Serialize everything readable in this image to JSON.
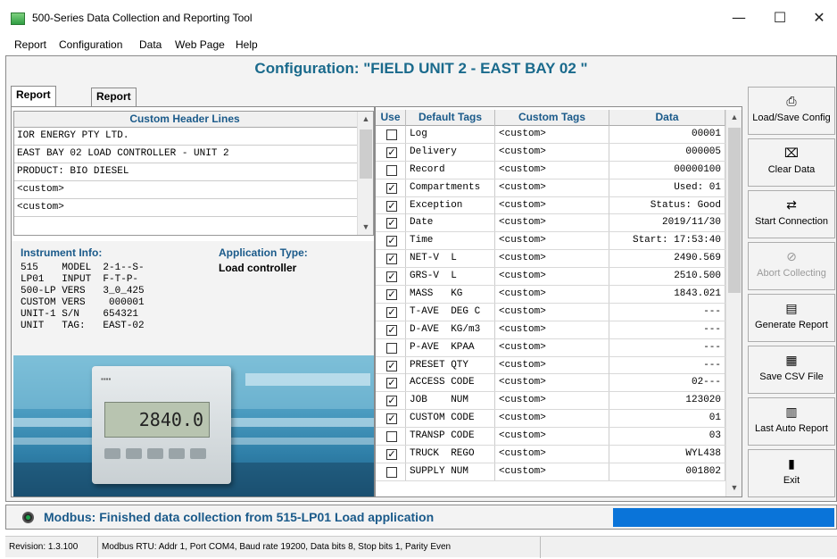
{
  "window": {
    "title": "500-Series Data Collection and Reporting Tool",
    "controls": {
      "minimize": "—",
      "maximize": "☐",
      "close": "✕"
    }
  },
  "menu": [
    "Report",
    "Configuration",
    "Data",
    "Web Page",
    "Help"
  ],
  "config_title": "Configuration: \"FIELD UNIT 2 - EAST BAY 02 \"",
  "tabs": [
    "Report Items",
    "Report Data"
  ],
  "header_lines": {
    "column": "Custom Header Lines",
    "lines": [
      "IOR ENERGY PTY LTD.",
      "EAST BAY 02 LOAD CONTROLLER - UNIT 2",
      "PRODUCT: BIO DIESEL",
      "<custom>",
      "<custom>",
      ""
    ]
  },
  "instrument": {
    "label": "Instrument Info:",
    "lines": [
      "515    MODEL  2-1--S-",
      "LP01   INPUT  F-T-P-",
      "500-LP VERS   3_0_425",
      "CUSTOM VERS    000001",
      "UNIT-1 S/N    654321",
      "UNIT   TAG:   EAST-02"
    ]
  },
  "application": {
    "label": "Application Type:",
    "value": "Load controller"
  },
  "device": {
    "display": "2840.0"
  },
  "tag_table": {
    "headers": {
      "use": "Use",
      "default": "Default Tags",
      "custom": "Custom Tags",
      "data": "Data"
    },
    "rows": [
      {
        "checked": false,
        "default": "Log",
        "custom": "<custom>",
        "data": "00001"
      },
      {
        "checked": true,
        "default": "Delivery",
        "custom": "<custom>",
        "data": "000005"
      },
      {
        "checked": false,
        "default": "Record",
        "custom": "<custom>",
        "data": "00000100"
      },
      {
        "checked": true,
        "default": "Compartments",
        "custom": "<custom>",
        "data": "Used: 01"
      },
      {
        "checked": true,
        "default": "Exception",
        "custom": "<custom>",
        "data": "Status: Good"
      },
      {
        "checked": true,
        "default": "Date",
        "custom": "<custom>",
        "data": "2019/11/30"
      },
      {
        "checked": true,
        "default": "Time",
        "custom": "<custom>",
        "data": "Start: 17:53:40"
      },
      {
        "checked": true,
        "default": "NET-V  L",
        "custom": "<custom>",
        "data": "2490.569"
      },
      {
        "checked": true,
        "default": "GRS-V  L",
        "custom": "<custom>",
        "data": "2510.500"
      },
      {
        "checked": true,
        "default": "MASS   KG",
        "custom": "<custom>",
        "data": "1843.021"
      },
      {
        "checked": true,
        "default": "T-AVE  DEG C",
        "custom": "<custom>",
        "data": "---"
      },
      {
        "checked": true,
        "default": "D-AVE  KG/m3",
        "custom": "<custom>",
        "data": "---"
      },
      {
        "checked": false,
        "default": "P-AVE  KPAA",
        "custom": "<custom>",
        "data": "---"
      },
      {
        "checked": true,
        "default": "PRESET QTY",
        "custom": "<custom>",
        "data": "---"
      },
      {
        "checked": true,
        "default": "ACCESS CODE",
        "custom": "<custom>",
        "data": "02---"
      },
      {
        "checked": true,
        "default": "JOB    NUM",
        "custom": "<custom>",
        "data": "123020"
      },
      {
        "checked": true,
        "default": "CUSTOM CODE",
        "custom": "<custom>",
        "data": "01"
      },
      {
        "checked": false,
        "default": "TRANSP CODE",
        "custom": "<custom>",
        "data": "03"
      },
      {
        "checked": true,
        "default": "TRUCK  REGO",
        "custom": "<custom>",
        "data": "WYL438"
      },
      {
        "checked": false,
        "default": "SUPPLY NUM",
        "custom": "<custom>",
        "data": "001802"
      }
    ]
  },
  "side_buttons": [
    {
      "label": "Load/Save Config",
      "icon": "save-config-icon",
      "glyph": "⎙"
    },
    {
      "label": "Clear Data",
      "icon": "clear-data-icon",
      "glyph": "⌧"
    },
    {
      "label": "Start Connection",
      "icon": "start-connection-icon",
      "glyph": "⇄"
    },
    {
      "label": "Abort Collecting",
      "icon": "abort-icon",
      "glyph": "⊘"
    },
    {
      "label": "Generate Report",
      "icon": "generate-report-icon",
      "glyph": "▤"
    },
    {
      "label": "Save CSV File",
      "icon": "csv-file-icon",
      "glyph": "▦"
    },
    {
      "label": "Last Auto Report",
      "icon": "last-report-icon",
      "glyph": "▥"
    },
    {
      "label": "Exit",
      "icon": "exit-icon",
      "glyph": "▮"
    }
  ],
  "status": {
    "message": "Modbus: Finished data collection from 515-LP01 Load application",
    "progress": 1.0,
    "progress_color": "#0a74d9"
  },
  "statusbar": {
    "revision": "Revision: 1.3.100",
    "connection": "Modbus RTU: Addr 1, Port COM4, Baud rate 19200, Data bits 8, Stop bits 1, Parity Even"
  }
}
